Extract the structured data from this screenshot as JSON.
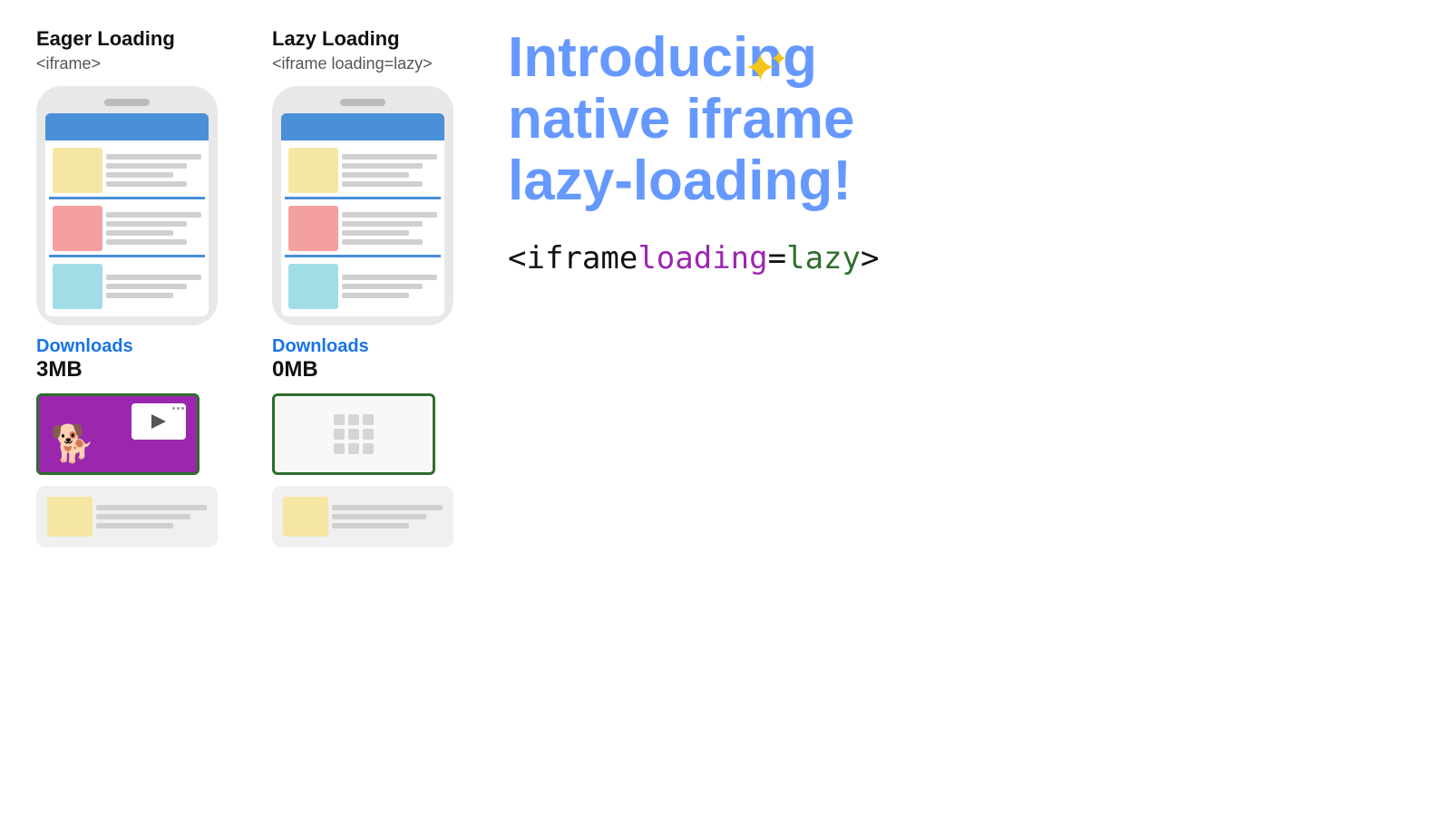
{
  "eager": {
    "title": "Eager Loading",
    "subtitle": "<iframe>",
    "downloads_label": "Downloads",
    "downloads_size": "3MB",
    "blocks": [
      {
        "color": "#f5e6a3"
      },
      {
        "color": "#f5a0a0"
      },
      {
        "color": "#a0dde6"
      }
    ]
  },
  "lazy": {
    "title": "Lazy Loading",
    "subtitle": "<iframe loading=lazy>",
    "downloads_label": "Downloads",
    "downloads_size": "0MB",
    "blocks": [
      {
        "color": "#f5e6a3"
      },
      {
        "color": "#f5a0a0"
      },
      {
        "color": "#a0dde6"
      }
    ]
  },
  "right": {
    "intro_line1": "Introducing",
    "intro_line2": "native iframe",
    "intro_line3": "lazy-loading!",
    "code_open": "<iframe",
    "code_attr": "loading",
    "code_equals": "=",
    "code_value": "lazy",
    "code_close": ">"
  },
  "sparkle": "✦✦"
}
